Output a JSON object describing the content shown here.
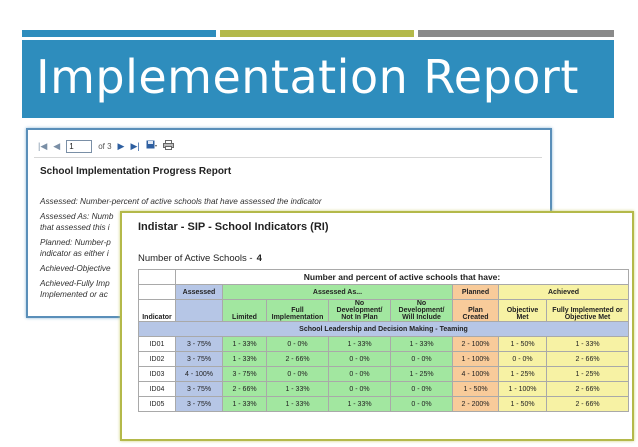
{
  "slide": {
    "title": "Implementation Report",
    "accent_colors": [
      "#2e8dbd",
      "#b4b94a",
      "#8a8a8a"
    ],
    "title_band_color": "#2e8dbd"
  },
  "report_viewer": {
    "toolbar": {
      "first_icon": "first-page-icon",
      "prev_icon": "prev-page-icon",
      "page_value": "1",
      "page_of": "of 3",
      "next_icon": "next-page-icon",
      "last_icon": "last-page-icon",
      "export_icon": "save-icon",
      "print_icon": "print-icon"
    },
    "title": "School Implementation Progress Report",
    "definitions": [
      "Assessed: Number-percent of active schools that have assessed the indicator",
      "Assessed As: Numb",
      "that assessed this i",
      "Planned: Number-p",
      "indicator as either i",
      "Achieved-Objective",
      "Achieved-Fully Imp",
      "Implemented or ac"
    ]
  },
  "indicators_report": {
    "title": "Indistar - SIP - School Indicators (RI)",
    "active_schools_label": "Number of Active Schools -",
    "active_schools_value": "4",
    "banner": "Number and percent of active schools that have:",
    "groups": {
      "assessed": "Assessed",
      "assessed_as": "Assessed As...",
      "planned": "Planned",
      "achieved": "Achieved"
    },
    "columns": {
      "indicator": "Indicator",
      "limited": "Limited",
      "full": "Full Implementation",
      "no_dev_not_in_plan": "No Development/ Not In Plan",
      "no_dev_will_include": "No Development/ Will Include",
      "plan_created": "Plan Created",
      "objective_met": "Objective Met",
      "fully_impl": "Fully Implemented or Objective Met"
    },
    "section": "School Leadership and Decision Making - Teaming",
    "rows": [
      {
        "id": "ID01",
        "assessed": "3 - 75%",
        "limited": "1 - 33%",
        "full": "0 - 0%",
        "nd_not": "1 - 33%",
        "nd_will": "1 - 33%",
        "plan": "2 - 100%",
        "obj": "1 - 50%",
        "fully": "1 - 33%"
      },
      {
        "id": "ID02",
        "assessed": "3 - 75%",
        "limited": "1 - 33%",
        "full": "2 - 66%",
        "nd_not": "0 - 0%",
        "nd_will": "0 - 0%",
        "plan": "1 - 100%",
        "obj": "0 - 0%",
        "fully": "2 - 66%"
      },
      {
        "id": "ID03",
        "assessed": "4 - 100%",
        "limited": "3 - 75%",
        "full": "0 - 0%",
        "nd_not": "0 - 0%",
        "nd_will": "1 - 25%",
        "plan": "4 - 100%",
        "obj": "1 - 25%",
        "fully": "1 - 25%"
      },
      {
        "id": "ID04",
        "assessed": "3 - 75%",
        "limited": "2 - 66%",
        "full": "1 - 33%",
        "nd_not": "0 - 0%",
        "nd_will": "0 - 0%",
        "plan": "1 - 50%",
        "obj": "1 - 100%",
        "fully": "2 - 66%"
      },
      {
        "id": "ID05",
        "assessed": "3 - 75%",
        "limited": "1 - 33%",
        "full": "1 - 33%",
        "nd_not": "1 - 33%",
        "nd_will": "0 - 0%",
        "plan": "2 - 200%",
        "obj": "1 - 50%",
        "fully": "2 - 66%"
      }
    ]
  }
}
